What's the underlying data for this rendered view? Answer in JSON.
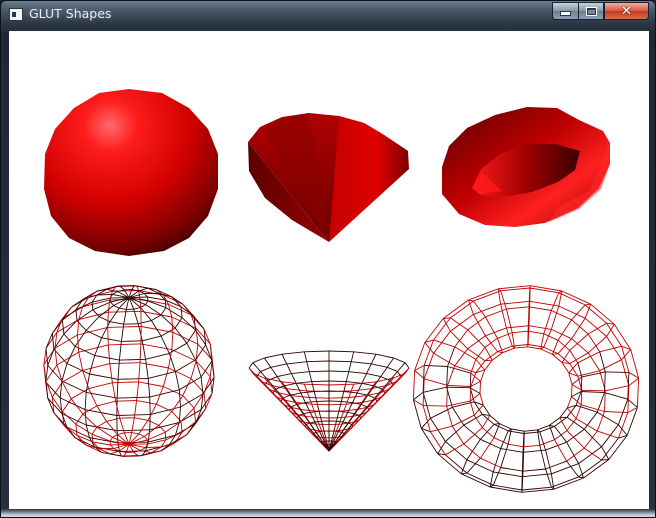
{
  "window": {
    "title": "GLUT Shapes",
    "app_icon": "glut-window-icon",
    "controls": {
      "minimize_icon": "minimize-icon",
      "maximize_icon": "maximize-icon",
      "close_icon": "close-icon"
    }
  },
  "scene": {
    "background": "#ffffff",
    "material_color": "#e00000",
    "wire_color": "#c00000",
    "shapes": [
      {
        "name": "solid-sphere",
        "mode": "solid"
      },
      {
        "name": "solid-cone",
        "mode": "solid"
      },
      {
        "name": "solid-torus",
        "mode": "solid"
      },
      {
        "name": "wire-sphere",
        "mode": "wireframe"
      },
      {
        "name": "wire-cone",
        "mode": "wireframe"
      },
      {
        "name": "wire-torus",
        "mode": "wireframe"
      }
    ]
  }
}
